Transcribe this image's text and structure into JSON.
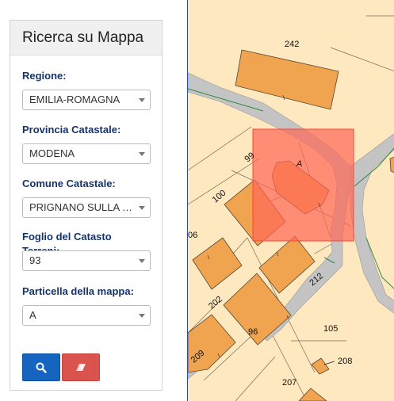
{
  "panel": {
    "title": "Ricerca su Mappa",
    "fields": [
      {
        "label": "Regione:",
        "value": "EMILIA-ROMAGNA"
      },
      {
        "label": "Provincia Catastale:",
        "value": "MODENA"
      },
      {
        "label": "Comune Catastale:",
        "value": "PRIGNANO SULLA S..."
      },
      {
        "label": "Foglio del Catasto Terreni:",
        "value": "93"
      },
      {
        "label": "Particella della mappa:",
        "value": "A"
      }
    ],
    "buttons": {
      "search_icon": "search-icon",
      "clear_icon": "eraser-icon"
    }
  },
  "map": {
    "parcel_labels": [
      "242",
      "99",
      "A",
      "100",
      "06",
      "202",
      "212",
      "96",
      "105",
      "209",
      "207",
      "208"
    ]
  },
  "colors": {
    "label": "#15336b",
    "search_button": "#1565c0",
    "clear_button": "#d9534f",
    "map_background": "#fde8c0",
    "building": "#f0a450",
    "road": "#c4c4c4",
    "highlight": "#ff6655"
  }
}
